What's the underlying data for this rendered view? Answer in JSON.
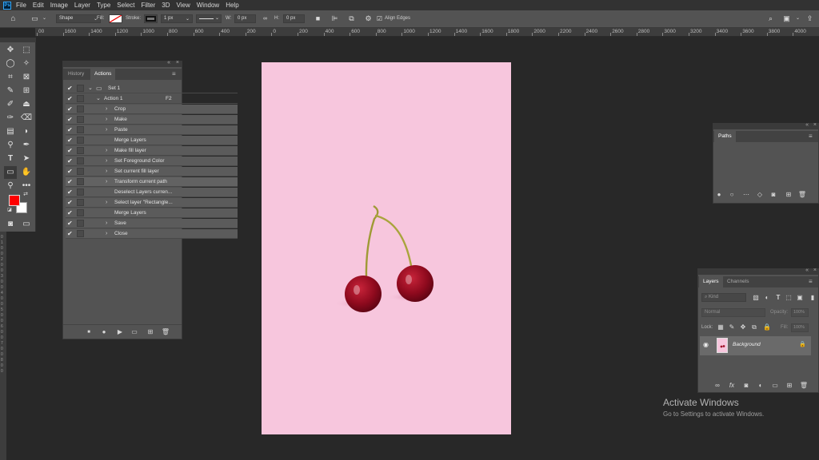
{
  "app": {
    "logo": "Ps"
  },
  "menu": [
    "File",
    "Edit",
    "Image",
    "Layer",
    "Type",
    "Select",
    "Filter",
    "3D",
    "View",
    "Window",
    "Help"
  ],
  "options": {
    "mode": "Shape",
    "fill_label": "Fill:",
    "stroke_label": "Stroke:",
    "stroke_width": "1 px",
    "w_label": "W:",
    "w_value": "0 px",
    "h_label": "H:",
    "h_value": "0 px",
    "align_edges": "Align Edges"
  },
  "ruler_top": [
    "00",
    "1600",
    "1400",
    "1200",
    "1000",
    "800",
    "600",
    "400",
    "200",
    "0",
    "200",
    "400",
    "600",
    "800",
    "1000",
    "1200",
    "1400",
    "1600",
    "1800",
    "2000",
    "2200",
    "2400",
    "2600",
    "2800",
    "3000",
    "3200",
    "3400",
    "3600",
    "3800",
    "4000",
    "4200"
  ],
  "ruler_left": "0 1 0 0 2 0 0 3 0 0 4 0 0 5 0 0 6 0 0 7 0 0 8 0 0",
  "toolbar": {
    "foreground_color": "#ff0000",
    "background_color": "#ffffff"
  },
  "actions_panel": {
    "tabs": [
      "History",
      "Actions"
    ],
    "active_tab": "Actions",
    "set_name": "Set 1",
    "action_name": "Action 1",
    "action_shortcut": "F2",
    "steps": [
      "Crop",
      "Make",
      "Paste",
      "Merge Layers",
      "Make fill layer",
      "Set Foreground Color",
      "Set current fill layer",
      "Transform current path",
      "Deselect Layers curren...",
      "Select layer \"Rectangle...",
      "Merge Layers",
      "Save",
      "Close"
    ]
  },
  "paths_panel": {
    "tab": "Paths"
  },
  "layers_panel": {
    "tabs": [
      "Layers",
      "Channels"
    ],
    "active_tab": "Layers",
    "kind_placeholder": "Kind",
    "blend_mode": "Normal",
    "opacity_label": "Opacity:",
    "opacity_value": "100%",
    "lock_label": "Lock:",
    "fill_label": "Fill:",
    "fill_value": "100%",
    "layer_name": "Background"
  },
  "canvas": {
    "background_color": "#f7c6dd"
  },
  "watermark": {
    "title": "Activate Windows",
    "subtitle": "Go to Settings to activate Windows."
  }
}
